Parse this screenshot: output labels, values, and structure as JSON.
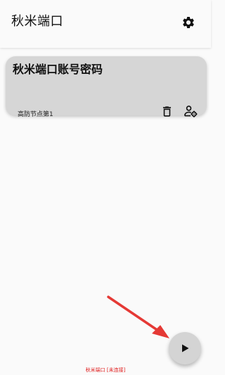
{
  "appbar": {
    "title": "秋米端口",
    "settings_icon": "gear-icon"
  },
  "server_card": {
    "title": "秋米端口账号密码",
    "subtitle": "高防节点第1",
    "delete_icon": "trash-icon",
    "user_settings_icon": "user-gear-icon"
  },
  "fab": {
    "icon": "play-icon"
  },
  "status": {
    "text": "秋米端口 [未连接]"
  },
  "colors": {
    "background": "#fafafa",
    "card": "#d6d6d6",
    "fab": "#d4d4d4",
    "status_text": "#e02020",
    "annotation_arrow": "#e53935"
  }
}
